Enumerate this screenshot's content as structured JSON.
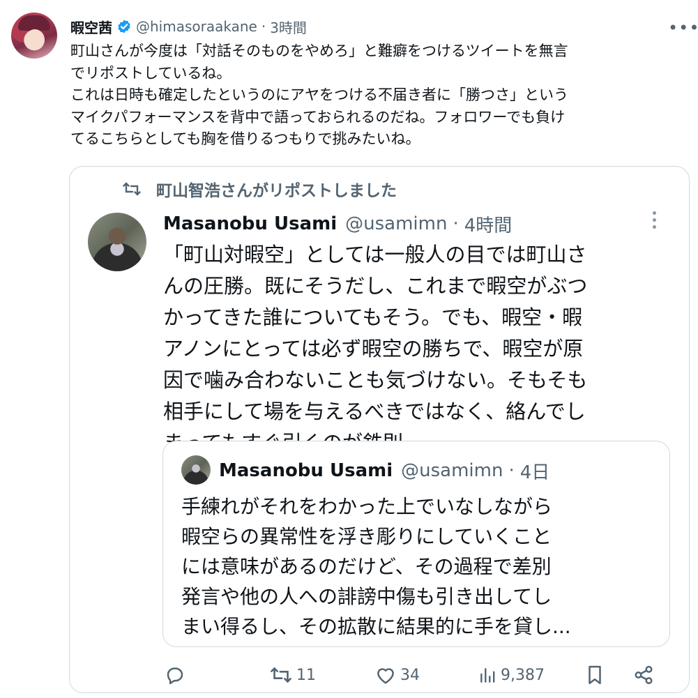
{
  "post": {
    "author_name": "暇空茜",
    "handle": "@himasoraakane",
    "separator": "·",
    "time": "3時間",
    "text": "町山さんが今度は「対話そのものをやめろ」と難癖をつけるツイートを無言\nでリポストしているね。\nこれは日時も確定したというのにアヤをつける不届き者に「勝つさ」という\nマイクパフォーマンスを背中で語っておられるのだね。フォロワーでも負け\nてるこちらとしても胸を借りるつもりで挑みたいね。"
  },
  "quoted": {
    "repost_label": "町山智浩さんがリポストしました",
    "author_name": "Masanobu Usami",
    "handle": "@usamimn",
    "separator": "·",
    "time": "4時間",
    "text": "「町山対暇空」としては一般人の目では町山さ\nんの圧勝。既にそうだし、これまで暇空がぶつ\nかってきた誰についてもそう。でも、暇空・暇\nアノンにとっては必ず暇空の勝ちで、暇空が原\n因で噛み合わないことも気づけない。そもそも\n相手にして場を与えるべきではなく、絡んでし\nまってもすぐ引くのが鉄則。",
    "inner": {
      "author_name": "Masanobu Usami",
      "handle": "@usamimn",
      "separator": "·",
      "time": "4日",
      "text": "手練れがそれをわかった上でいなしながら\n暇空らの異常性を浮き彫りにしていくこと\nには意味があるのだけど、その過程で差別\n発言や他の人への誹謗中傷も引き出してし\nまい得るし、その拡散に結果的に手を貸し..."
    },
    "stats": {
      "reposts": "11",
      "likes": "34",
      "views": "9,387"
    }
  },
  "icons": {
    "verified": "verified-badge-icon",
    "more": "more-icon",
    "repost": "repost-icon",
    "reply": "reply-icon",
    "like": "heart-icon",
    "views": "views-icon",
    "bookmark": "bookmark-icon",
    "share": "share-icon"
  },
  "colors": {
    "verified_blue": "#1d9bf0",
    "muted_text": "#536471",
    "border": "#cfd9de"
  }
}
